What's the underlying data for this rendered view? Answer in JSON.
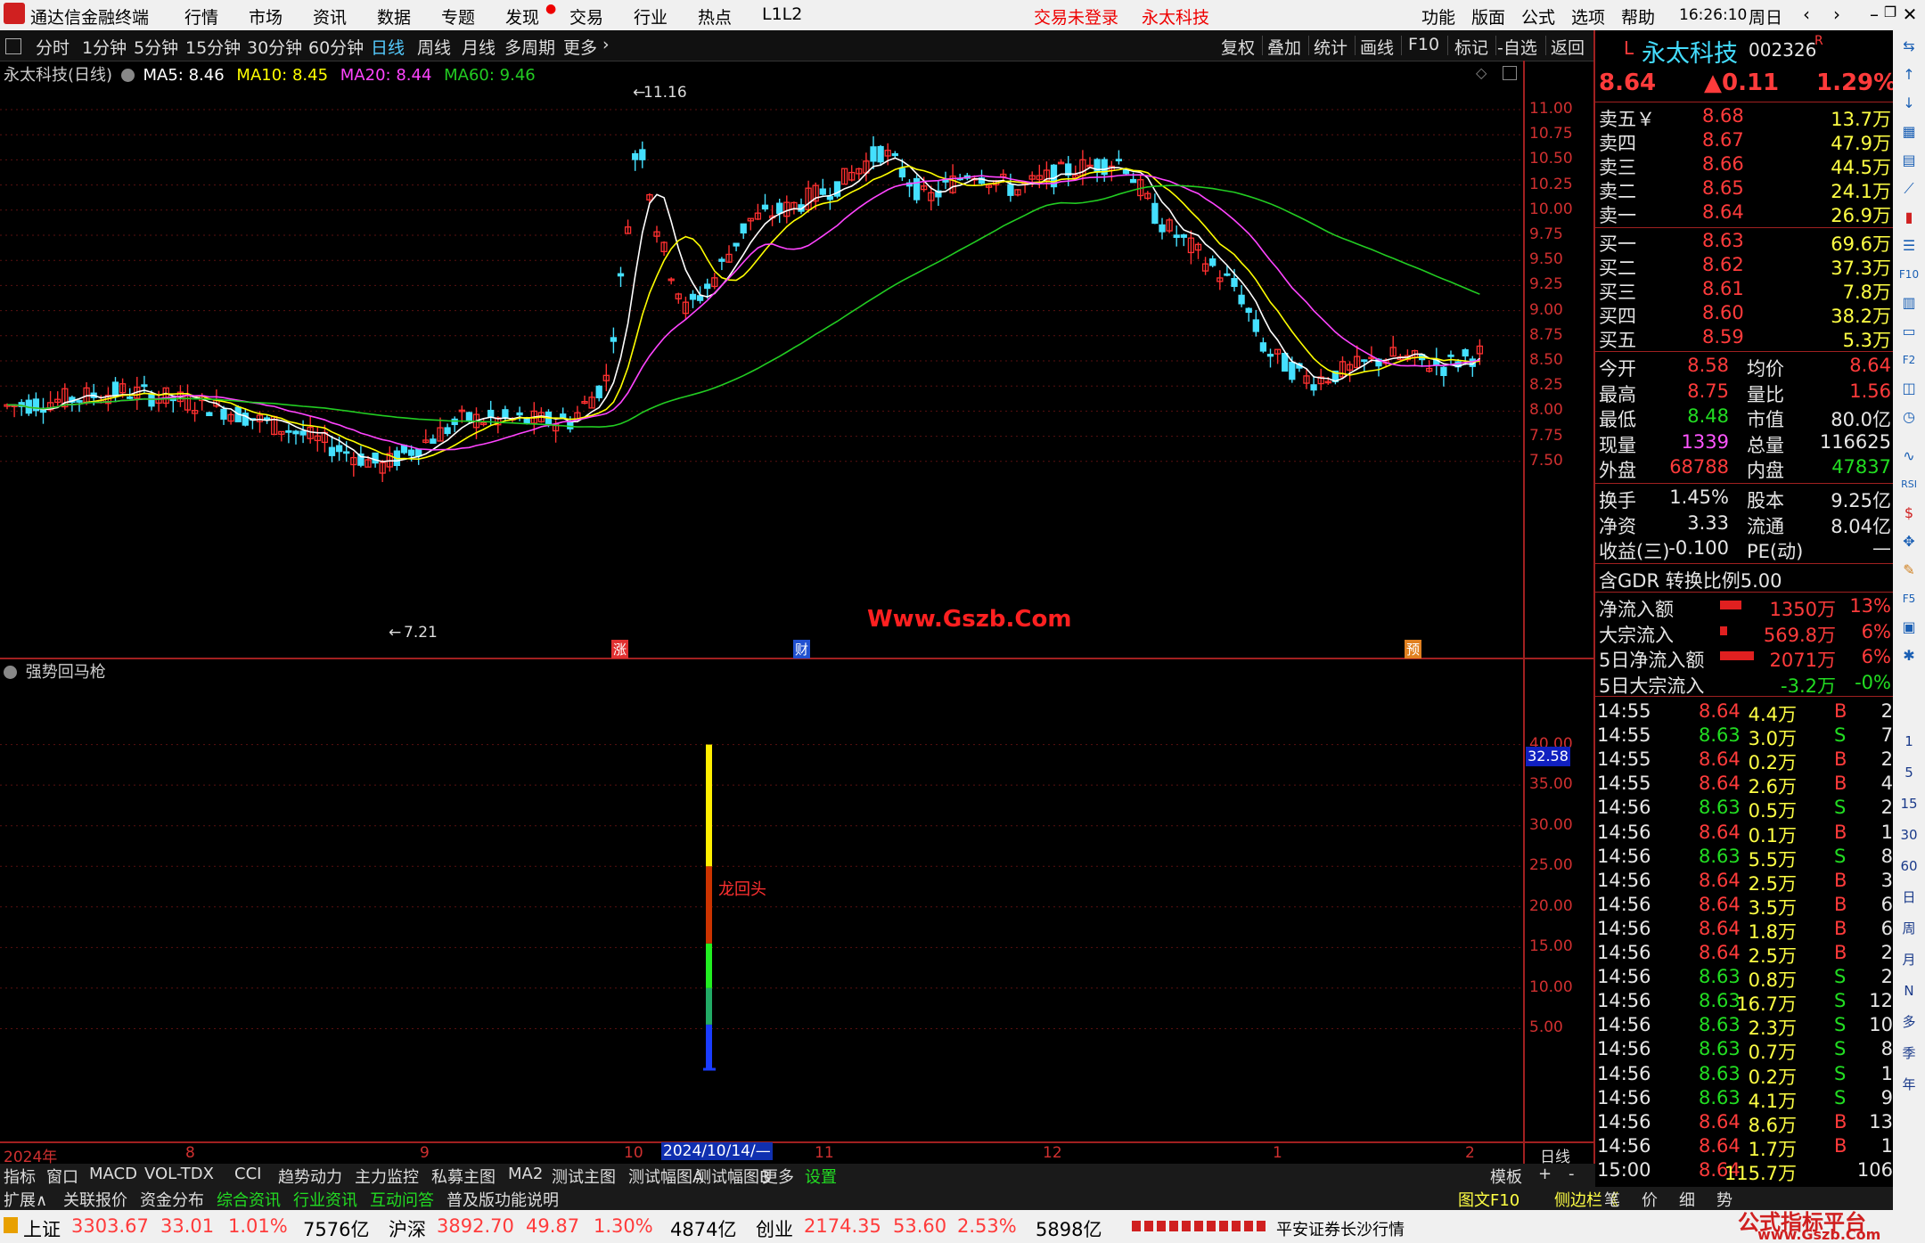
{
  "menubar": {
    "app_title": "通达信金融终端",
    "menus": [
      "行情",
      "市场",
      "资讯",
      "数据",
      "专题",
      "发现",
      "交易",
      "行业",
      "热点",
      "L1L2"
    ],
    "center_notice": "交易未登录",
    "center_stock": "永太科技",
    "right_menus": [
      "功能",
      "版面",
      "公式",
      "选项",
      "帮助"
    ],
    "time": "16:26:10",
    "weekday": "周日"
  },
  "toolbar": {
    "periods": [
      "分时",
      "1分钟",
      "5分钟",
      "15分钟",
      "30分钟",
      "60分钟",
      "日线",
      "周线",
      "月线",
      "多周期",
      "更多"
    ],
    "active_period": "日线",
    "actions": [
      "复权",
      "叠加",
      "统计",
      "画线",
      "F10",
      "标记",
      "-自选",
      "返回"
    ]
  },
  "chart_header": {
    "title": "永太科技(日线)",
    "ma5": "MA5: 8.46",
    "ma10": "MA10: 8.45",
    "ma20": "MA20: 8.44",
    "ma60": "MA60: 9.46",
    "colors": {
      "ma5": "#ffffff",
      "ma10": "#ffff00",
      "ma20": "#ff44ff",
      "ma60": "#22cc22",
      "up": "#ff3030",
      "down": "#44e0ff",
      "axis": "#a02020"
    }
  },
  "price_axis": [
    "11.00",
    "10.75",
    "10.50",
    "10.25",
    "10.00",
    "9.75",
    "9.50",
    "9.25",
    "9.00",
    "8.75",
    "8.50",
    "8.25",
    "8.00",
    "7.75",
    "7.50"
  ],
  "annotations": {
    "high_label": "11.16",
    "low_label": "7.21",
    "watermark": "Www.Gszb.Com",
    "event_markers": [
      "涨",
      "财",
      "预"
    ]
  },
  "indicator": {
    "name": "强势回马枪",
    "axis": [
      "40.00",
      "35.00",
      "30.00",
      "25.00",
      "20.00",
      "15.00",
      "10.00",
      "5.00"
    ],
    "current_value": "32.58",
    "signal_label": "龙回头"
  },
  "chart_data": {
    "type": "candlestick",
    "ma_series": [
      "MA5",
      "MA10",
      "MA20",
      "MA60"
    ],
    "price_high": 11.16,
    "price_low": 7.21,
    "indicator_bar": {
      "date": "2024/10/14",
      "max": 40,
      "segments": [
        {
          "from": 0,
          "to": 5.5,
          "color": "#1a3cff"
        },
        {
          "from": 5.5,
          "to": 10,
          "color": "#22aa66"
        },
        {
          "from": 10,
          "to": 15.5,
          "color": "#22ee22"
        },
        {
          "from": 15.5,
          "to": 25,
          "color": "#cc3300"
        },
        {
          "from": 25,
          "to": 40,
          "color": "#ffee00"
        }
      ]
    }
  },
  "date_axis": [
    "2024年",
    "8",
    "9",
    "10",
    "2024/10/14/—",
    "11",
    "12",
    "1",
    "2"
  ],
  "date_axis_right": "日线",
  "quote": {
    "prefix": "L",
    "name": "永太科技",
    "code": "002326",
    "code_badge": "R",
    "price": "8.64",
    "change": "▲0.11",
    "change_pct": "1.29%",
    "asks": [
      {
        "label": "卖五￥",
        "price": "8.68",
        "vol": "13.7万"
      },
      {
        "label": "卖四",
        "price": "8.67",
        "vol": "47.9万"
      },
      {
        "label": "卖三",
        "price": "8.66",
        "vol": "44.5万"
      },
      {
        "label": "卖二",
        "price": "8.65",
        "vol": "24.1万"
      },
      {
        "label": "卖一",
        "price": "8.64",
        "vol": "26.9万"
      }
    ],
    "bids": [
      {
        "label": "买一",
        "price": "8.63",
        "vol": "69.6万"
      },
      {
        "label": "买二",
        "price": "8.62",
        "vol": "37.3万"
      },
      {
        "label": "买三",
        "price": "8.61",
        "vol": "7.8万"
      },
      {
        "label": "买四",
        "price": "8.60",
        "vol": "38.2万"
      },
      {
        "label": "买五",
        "price": "8.59",
        "vol": "5.3万"
      }
    ],
    "stats": [
      {
        "l1": "今开",
        "v1": "8.58",
        "c1": "red",
        "l2": "均价",
        "v2": "8.64",
        "c2": "red"
      },
      {
        "l1": "最高",
        "v1": "8.75",
        "c1": "red",
        "l2": "量比",
        "v2": "1.56",
        "c2": "red"
      },
      {
        "l1": "最低",
        "v1": "8.48",
        "c1": "green",
        "l2": "市值",
        "v2": "80.0亿",
        "c2": "white"
      },
      {
        "l1": "现量",
        "v1": "1339",
        "c1": "mag",
        "l2": "总量",
        "v2": "116625",
        "c2": "white"
      },
      {
        "l1": "外盘",
        "v1": "68788",
        "c1": "red",
        "l2": "内盘",
        "v2": "47837",
        "c2": "green"
      }
    ],
    "stats2": [
      {
        "l1": "换手",
        "v1": "1.45%",
        "l2": "股本",
        "v2": "9.25亿"
      },
      {
        "l1": "净资",
        "v1": "3.33",
        "l2": "流通",
        "v2": "8.04亿"
      },
      {
        "l1": "收益(三)",
        "v1": "-0.100",
        "l2": "PE(动)",
        "v2": "—"
      }
    ],
    "gdr": "含GDR 转换比例5.00",
    "flows": [
      {
        "label": "净流入额",
        "value": "1350万",
        "pct": "13%",
        "c": "red"
      },
      {
        "label": "大宗流入",
        "value": "569.8万",
        "pct": "6%",
        "c": "red"
      },
      {
        "label": "5日净流入额",
        "value": "2071万",
        "pct": "6%",
        "c": "red"
      },
      {
        "label": "5日大宗流入",
        "value": "-3.2万",
        "pct": "-0%",
        "c": "green"
      }
    ],
    "ticks": [
      {
        "t": "14:55",
        "p": "8.64",
        "v": "4.4万",
        "d": "B",
        "n": "2"
      },
      {
        "t": "14:55",
        "p": "8.63",
        "v": "3.0万",
        "d": "S",
        "n": "7"
      },
      {
        "t": "14:55",
        "p": "8.64",
        "v": "0.2万",
        "d": "B",
        "n": "2"
      },
      {
        "t": "14:55",
        "p": "8.64",
        "v": "2.6万",
        "d": "B",
        "n": "4"
      },
      {
        "t": "14:56",
        "p": "8.63",
        "v": "0.5万",
        "d": "S",
        "n": "2"
      },
      {
        "t": "14:56",
        "p": "8.64",
        "v": "0.1万",
        "d": "B",
        "n": "1"
      },
      {
        "t": "14:56",
        "p": "8.63",
        "v": "5.5万",
        "d": "S",
        "n": "8"
      },
      {
        "t": "14:56",
        "p": "8.64",
        "v": "2.5万",
        "d": "B",
        "n": "3"
      },
      {
        "t": "14:56",
        "p": "8.64",
        "v": "3.5万",
        "d": "B",
        "n": "6"
      },
      {
        "t": "14:56",
        "p": "8.64",
        "v": "1.8万",
        "d": "B",
        "n": "6"
      },
      {
        "t": "14:56",
        "p": "8.64",
        "v": "2.5万",
        "d": "B",
        "n": "2"
      },
      {
        "t": "14:56",
        "p": "8.63",
        "v": "0.8万",
        "d": "S",
        "n": "2"
      },
      {
        "t": "14:56",
        "p": "8.63",
        "v": "16.7万",
        "d": "S",
        "n": "12"
      },
      {
        "t": "14:56",
        "p": "8.63",
        "v": "2.3万",
        "d": "S",
        "n": "10"
      },
      {
        "t": "14:56",
        "p": "8.63",
        "v": "0.7万",
        "d": "S",
        "n": "8"
      },
      {
        "t": "14:56",
        "p": "8.63",
        "v": "0.2万",
        "d": "S",
        "n": "1"
      },
      {
        "t": "14:56",
        "p": "8.63",
        "v": "4.1万",
        "d": "S",
        "n": "9"
      },
      {
        "t": "14:56",
        "p": "8.64",
        "v": "8.6万",
        "d": "B",
        "n": "13"
      },
      {
        "t": "14:56",
        "p": "8.64",
        "v": "1.7万",
        "d": "B",
        "n": "1"
      },
      {
        "t": "15:00",
        "p": "8.64",
        "v": "115.7万",
        "d": "",
        "n": "106"
      }
    ]
  },
  "tabs1": [
    "指标",
    "窗口",
    "MACD",
    "VOL-TDX",
    "CCI",
    "趋势动力",
    "主力监控",
    "私募主图",
    "MA2",
    "测试主图",
    "测试幅图A",
    "测试幅图B",
    "更多",
    "设置"
  ],
  "tabs1_right": [
    "模板",
    "+",
    "-"
  ],
  "tabs2": [
    "扩展∧",
    "关联报价",
    "资金分布",
    "综合资讯",
    "行业资讯",
    "互动问答",
    "普及版功能说明"
  ],
  "tabs2_right": [
    "图文F10",
    "侧边栏《",
    "笔",
    "价",
    "细",
    "势"
  ],
  "sidestrip": [
    "1",
    "5",
    "15",
    "30",
    "60",
    "日",
    "周",
    "月",
    "N",
    "多",
    "季",
    "年"
  ],
  "status": {
    "sh_label": "上证",
    "sh_val": "3303.67",
    "sh_chg": "33.01",
    "sh_pct": "1.01%",
    "sh_amt": "7576亿",
    "hs_label": "沪深",
    "hs_val": "3892.70",
    "hs_chg": "49.87",
    "hs_pct": "1.30%",
    "hs_amt": "4874亿",
    "cy_label": "创业",
    "cy_val": "2174.35",
    "cy_chg": "53.60",
    "cy_pct": "2.53%",
    "cy_amt": "5898亿",
    "broker": "平安证券长沙行情",
    "brand": "公式指标平台",
    "brand_url": "www.Gszb.Com"
  }
}
